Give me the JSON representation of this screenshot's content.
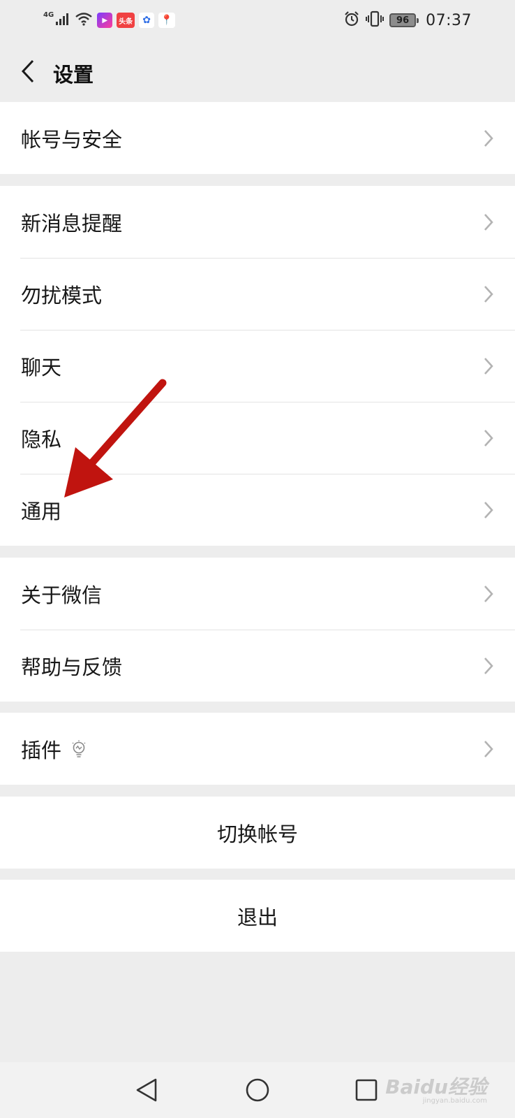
{
  "status_bar": {
    "network": "4G",
    "app_badges": [
      "▶",
      "头条",
      "✿",
      "📍"
    ],
    "battery": "96",
    "time": "07:37"
  },
  "header": {
    "title": "设置"
  },
  "groups": [
    {
      "items": [
        {
          "label": "帐号与安全"
        }
      ]
    },
    {
      "items": [
        {
          "label": "新消息提醒"
        },
        {
          "label": "勿扰模式"
        },
        {
          "label": "聊天"
        },
        {
          "label": "隐私"
        },
        {
          "label": "通用"
        }
      ]
    },
    {
      "items": [
        {
          "label": "关于微信"
        },
        {
          "label": "帮助与反馈"
        }
      ]
    },
    {
      "items": [
        {
          "label": "插件",
          "icon": "lightbulb-icon"
        }
      ]
    }
  ],
  "actions": {
    "switch_account": "切换帐号",
    "logout": "退出"
  },
  "watermark": {
    "brand": "Baidu经验",
    "url": "jingyan.baidu.com"
  },
  "colors": {
    "background": "#ededed",
    "card": "#ffffff",
    "divider": "#e3e3e3",
    "annotation_arrow": "#c0140f"
  }
}
